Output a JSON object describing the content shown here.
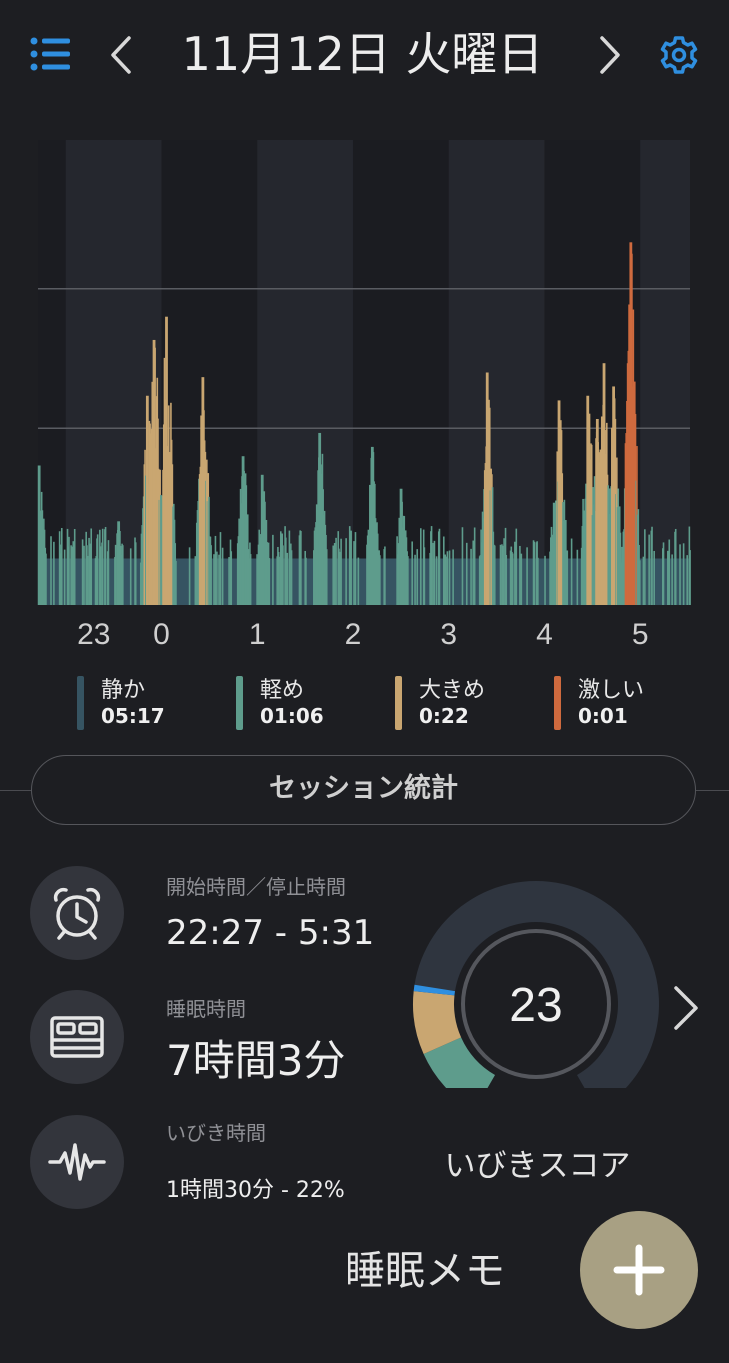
{
  "header": {
    "title": "11月12日 火曜日"
  },
  "colors": {
    "background": "#1d1e22",
    "accent_blue": "#2f8fe0",
    "quiet": "#365462",
    "light": "#5e9c8c",
    "loud": "#c9a671",
    "epic": "#cf6a3e"
  },
  "chart_data": {
    "type": "bar",
    "x_ticks": [
      "23",
      "0",
      "1",
      "2",
      "3",
      "4",
      "5"
    ],
    "x_range": [
      22.71,
      5.52
    ],
    "ylim": [
      0,
      100
    ],
    "gridlines": [
      38,
      68
    ],
    "baseline_level": 10,
    "series": [
      {
        "name": "静か",
        "color": "#365462"
      },
      {
        "name": "軽め",
        "color": "#5e9c8c"
      },
      {
        "name": "大きめ",
        "color": "#c9a671"
      },
      {
        "name": "激しい",
        "color": "#cf6a3e"
      }
    ],
    "peaks": [
      {
        "x": 22.72,
        "y": 30,
        "level": "軽め"
      },
      {
        "x": 23.55,
        "y": 18,
        "level": "軽め"
      },
      {
        "x": 23.85,
        "y": 45,
        "level": "大きめ"
      },
      {
        "x": 23.92,
        "y": 57,
        "level": "大きめ"
      },
      {
        "x": 24.05,
        "y": 62,
        "level": "大きめ"
      },
      {
        "x": 24.43,
        "y": 49,
        "level": "大きめ"
      },
      {
        "x": 24.85,
        "y": 32,
        "level": "軽め"
      },
      {
        "x": 25.05,
        "y": 28,
        "level": "軽め"
      },
      {
        "x": 25.65,
        "y": 37,
        "level": "軽め"
      },
      {
        "x": 26.2,
        "y": 34,
        "level": "軽め"
      },
      {
        "x": 26.5,
        "y": 25,
        "level": "軽め"
      },
      {
        "x": 27.4,
        "y": 50,
        "level": "大きめ"
      },
      {
        "x": 28.1,
        "y": 22,
        "level": "軽め"
      },
      {
        "x": 28.15,
        "y": 44,
        "level": "大きめ"
      },
      {
        "x": 28.45,
        "y": 45,
        "level": "大きめ"
      },
      {
        "x": 28.55,
        "y": 40,
        "level": "大きめ"
      },
      {
        "x": 28.62,
        "y": 52,
        "level": "大きめ"
      },
      {
        "x": 28.72,
        "y": 47,
        "level": "大きめ"
      },
      {
        "x": 28.9,
        "y": 78,
        "level": "激しい"
      }
    ]
  },
  "legend": [
    {
      "name": "静か",
      "value": "05:17",
      "color": "#365462"
    },
    {
      "name": "軽め",
      "value": "01:06",
      "color": "#5e9c8c"
    },
    {
      "name": "大きめ",
      "value": "0:22",
      "color": "#c9a671"
    },
    {
      "name": "激しい",
      "value": "0:01",
      "color": "#cf6a3e"
    }
  ],
  "session": {
    "button_label": "セッション統計"
  },
  "stats": {
    "time": {
      "label": "開始時間／停止時間",
      "value": "22:27 - 5:31",
      "icon": "alarm-clock-icon"
    },
    "sleep": {
      "label": "睡眠時間",
      "value": "7時間3分",
      "icon": "bed-icon"
    },
    "snore": {
      "label": "いびき時間",
      "value": "1時間30分 - 22%",
      "icon": "waveform-icon"
    }
  },
  "score": {
    "value": "23",
    "label": "いびきスコア",
    "segments": [
      {
        "level": "軽め",
        "fraction": 0.12
      },
      {
        "level": "大きめ",
        "fraction": 0.1
      },
      {
        "level": "激しい",
        "fraction": 0.01
      }
    ]
  },
  "memo": {
    "label": "睡眠メモ",
    "add_icon": "plus-icon"
  }
}
